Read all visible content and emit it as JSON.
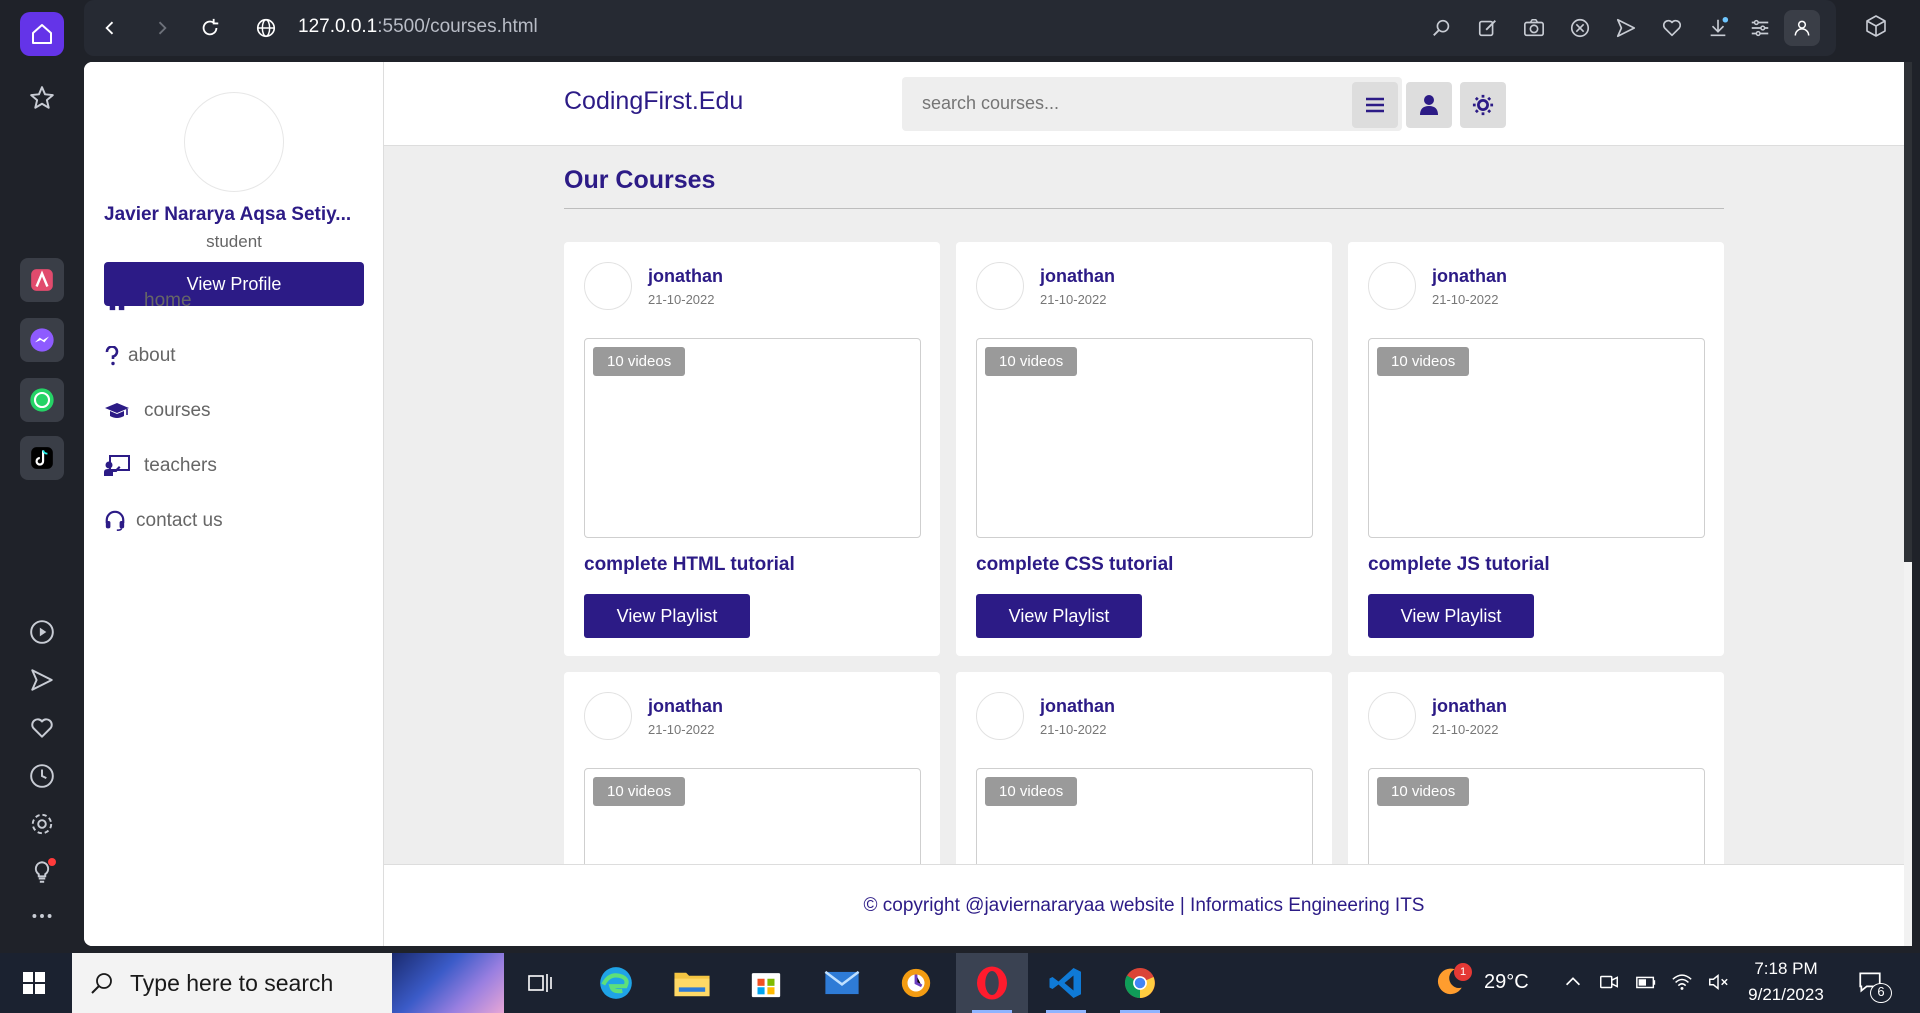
{
  "browser": {
    "url_host": "127.0.0.1",
    "url_path": ":5500/courses.html"
  },
  "site": {
    "logo": "CodingFirst.Edu",
    "search_placeholder": "search courses..."
  },
  "sidebar": {
    "user_name": "Javier Nararya Aqsa Setiy...",
    "user_role": "student",
    "view_profile_label": "View Profile",
    "links": [
      {
        "label": "home",
        "icon": "home-icon"
      },
      {
        "label": "about",
        "icon": "question-icon"
      },
      {
        "label": "courses",
        "icon": "graduation-cap-icon"
      },
      {
        "label": "teachers",
        "icon": "chalkboard-teacher-icon"
      },
      {
        "label": "contact us",
        "icon": "headset-icon"
      }
    ]
  },
  "main": {
    "heading": "Our Courses",
    "courses": [
      {
        "author": "jonathan",
        "date": "21-10-2022",
        "badge": "10 videos",
        "title": "complete HTML tutorial",
        "button": "View Playlist"
      },
      {
        "author": "jonathan",
        "date": "21-10-2022",
        "badge": "10 videos",
        "title": "complete CSS tutorial",
        "button": "View Playlist"
      },
      {
        "author": "jonathan",
        "date": "21-10-2022",
        "badge": "10 videos",
        "title": "complete JS tutorial",
        "button": "View Playlist"
      },
      {
        "author": "jonathan",
        "date": "21-10-2022",
        "badge": "10 videos"
      },
      {
        "author": "jonathan",
        "date": "21-10-2022",
        "badge": "10 videos"
      },
      {
        "author": "jonathan",
        "date": "21-10-2022",
        "badge": "10 videos"
      }
    ]
  },
  "footer": {
    "text": "© copyright @javiernararyaa website | Informatics Engineering ITS"
  },
  "taskbar": {
    "search_placeholder": "Type here to search",
    "temperature": "29°C",
    "weather_badge": "1",
    "time": "7:18 PM",
    "date": "9/21/2023",
    "notification_count": "6"
  },
  "colors": {
    "brand": "#2c1b86",
    "opera_accent": "#6434e8",
    "page_bg": "#eeeeee"
  }
}
